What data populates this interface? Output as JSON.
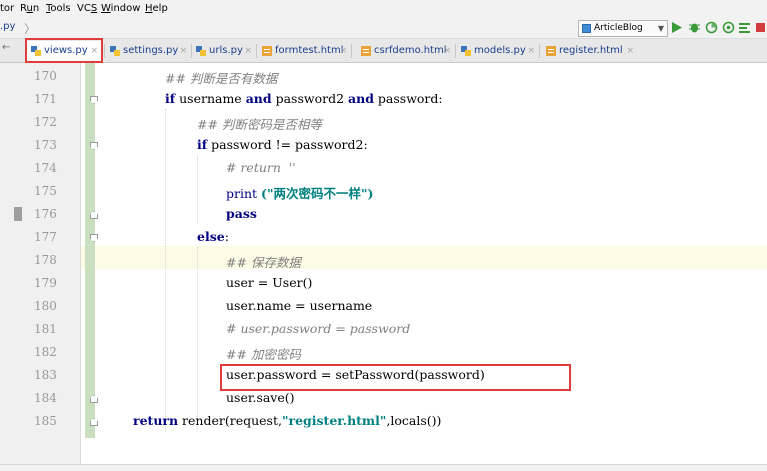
{
  "menubar": {
    "items": [
      {
        "label": "tor"
      },
      {
        "label": "Run",
        "mnemonic": "u"
      },
      {
        "label": "Tools",
        "mnemonic": "T"
      },
      {
        "label": "VCS",
        "mnemonic": "S"
      },
      {
        "label": "Window",
        "mnemonic": "W"
      },
      {
        "label": "Help",
        "mnemonic": "H"
      }
    ]
  },
  "navbar": {
    "breadcrumb": ".py",
    "run_config": "ArticleBlog",
    "icons": [
      "run-icon",
      "debug-icon",
      "coverage-icon",
      "profile-icon",
      "concurrency-icon",
      "stop-icon"
    ]
  },
  "tabs": [
    {
      "label": "views.py",
      "file_type": "python",
      "active": true,
      "close": "×"
    },
    {
      "label": "settings.py",
      "file_type": "python",
      "active": false,
      "close": "×"
    },
    {
      "label": "urls.py",
      "file_type": "python",
      "active": false,
      "close": "×"
    },
    {
      "label": "formtest.html",
      "file_type": "html",
      "active": false,
      "close": "×"
    },
    {
      "label": "csrfdemo.html",
      "file_type": "html",
      "active": false,
      "close": "×"
    },
    {
      "label": "models.py",
      "file_type": "python",
      "active": false,
      "close": "×"
    },
    {
      "label": "register.html",
      "file_type": "html",
      "active": false,
      "close": "×"
    }
  ],
  "editor": {
    "highlighted_line": 178,
    "lines": [
      {
        "n": "170",
        "code": "## 判断是否有数据"
      },
      {
        "n": "171",
        "kw1": "if",
        "t1": " username ",
        "kw2": "and",
        "t2": " password2 ",
        "kw3": "and",
        "t3": " password:"
      },
      {
        "n": "172",
        "code": "## 判断密码是否相等"
      },
      {
        "n": "173",
        "kw1": "if",
        "t1": " password != password2:"
      },
      {
        "n": "174",
        "code": "# return  ''"
      },
      {
        "n": "175",
        "t1": "print ",
        "st1": "(\"两次密码不一样\")"
      },
      {
        "n": "176",
        "kw1": "pass"
      },
      {
        "n": "177",
        "kw1": "else",
        "t1": ":"
      },
      {
        "n": "178",
        "code": "## 保存数据"
      },
      {
        "n": "179",
        "code": "user = User()"
      },
      {
        "n": "180",
        "code": "user.name = username"
      },
      {
        "n": "181",
        "code": "# user.password = password"
      },
      {
        "n": "182",
        "code": "## 加密密码"
      },
      {
        "n": "183",
        "code": "user.password = setPassword(password)"
      },
      {
        "n": "184",
        "code": "user.save()"
      },
      {
        "n": "185",
        "kw1": "return",
        "t1": " render(request,",
        "st1": "\"register.html\"",
        "t2": ",locals())"
      }
    ]
  },
  "colors": {
    "keyword": "#000080",
    "comment": "#808080",
    "string": "#008080",
    "highlight_box": "#e03c3c",
    "vcs_added": "#c9dfbf"
  }
}
